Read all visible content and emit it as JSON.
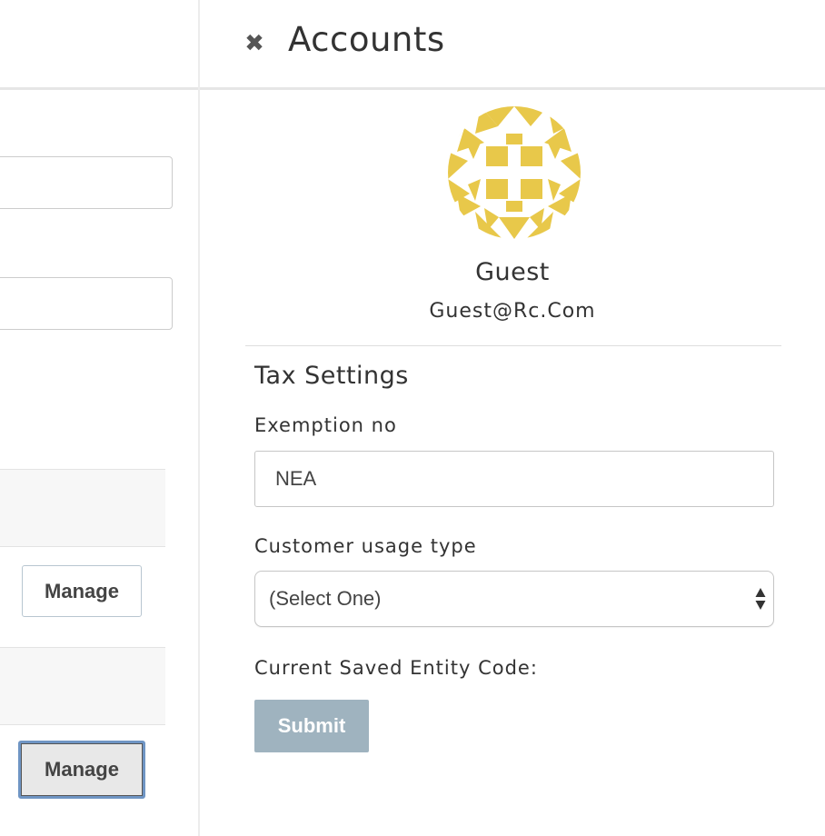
{
  "background": {
    "manage_buttons": [
      "Manage",
      "Manage"
    ]
  },
  "panel": {
    "title": "Accounts",
    "close_icon": "close-icon",
    "user": {
      "name": "Guest",
      "email": "Guest@Rc.Com",
      "avatar_color": "#e8c84a"
    },
    "tax_settings": {
      "title": "Tax Settings",
      "exemption_label": "Exemption no",
      "exemption_value": "NEA",
      "usage_type_label": "Customer usage type",
      "usage_type_selected": "(Select One)",
      "entity_code_label": "Current Saved Entity Code:",
      "submit_label": "Submit"
    }
  },
  "colors": {
    "submit_button": "#9fb3bf",
    "focus_outline": "#6f95c4"
  }
}
